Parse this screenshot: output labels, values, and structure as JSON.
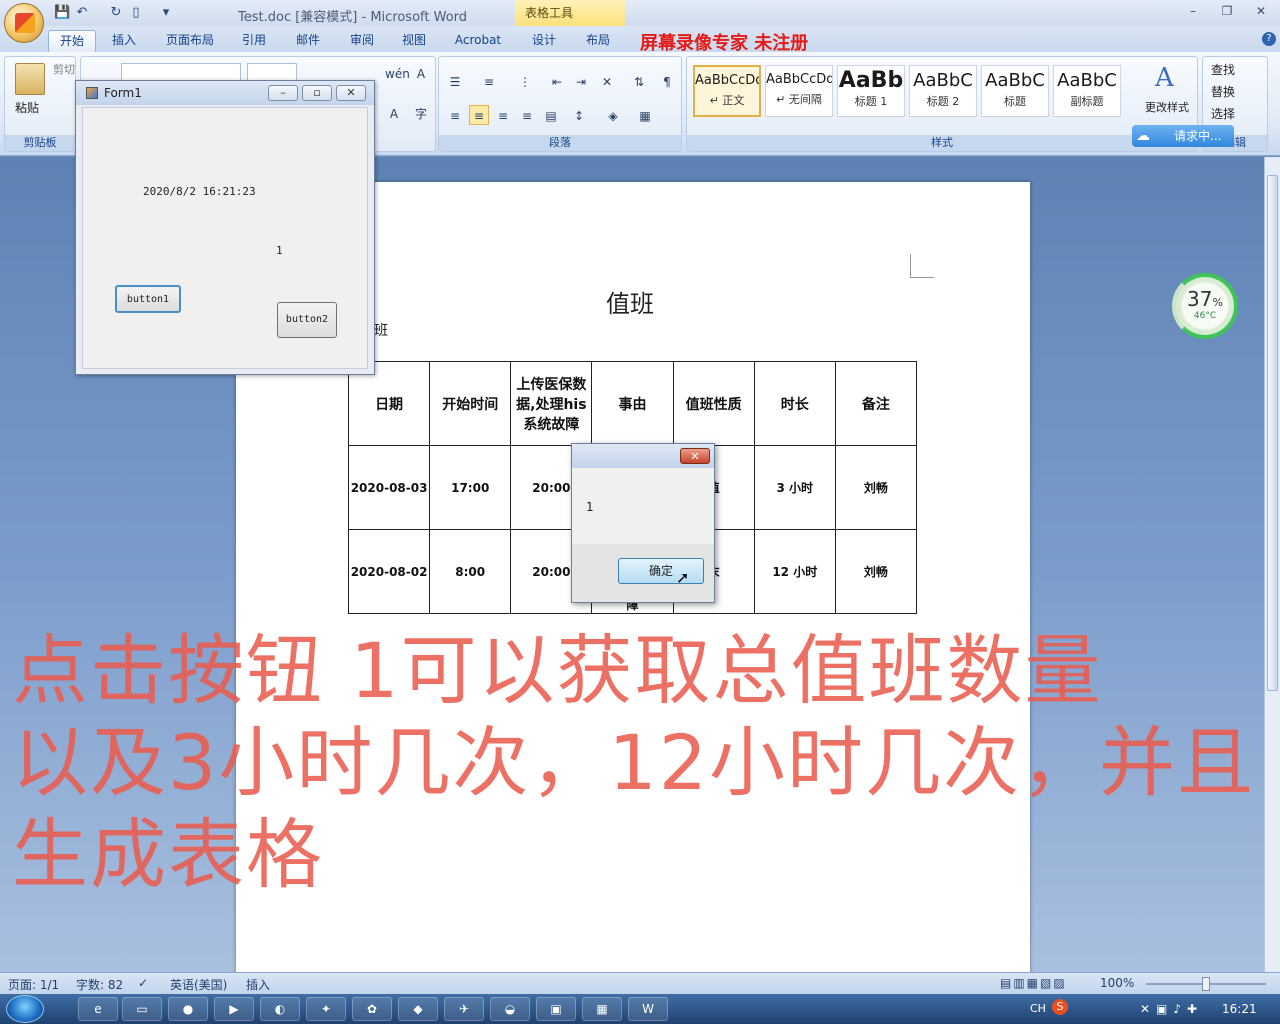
{
  "window": {
    "title": "Test.doc [兼容模式] - Microsoft Word",
    "context_tab": "表格工具",
    "controls": [
      "–",
      "❐",
      "✕"
    ]
  },
  "tabs": [
    {
      "label": "开始"
    },
    {
      "label": "插入"
    },
    {
      "label": "页面布局"
    },
    {
      "label": "引用"
    },
    {
      "label": "邮件"
    },
    {
      "label": "审阅"
    },
    {
      "label": "视图"
    },
    {
      "label": "Acrobat"
    },
    {
      "label": "设计"
    },
    {
      "label": "布局"
    }
  ],
  "recorder_watermark": "屏幕录像专家  未注册",
  "ribbon": {
    "clipboard": {
      "paste": "粘贴",
      "cut": "剪切",
      "label": "剪贴板"
    },
    "paragraph_label": "段落",
    "styles_label": "样式",
    "styles": [
      {
        "sample": "AaBbCcDd",
        "name": "↵ 正文"
      },
      {
        "sample": "AaBbCcDd",
        "name": "↵ 无间隔"
      },
      {
        "sample": "AaBb",
        "name": "标题 1"
      },
      {
        "sample": "AaBbC",
        "name": "标题 2"
      },
      {
        "sample": "AaBbC",
        "name": "标题"
      },
      {
        "sample": "AaBbC",
        "name": "副标题"
      }
    ],
    "change_styles": "更改样式",
    "editing": {
      "find": "查找",
      "replace": "替换",
      "select": "选择",
      "label": "编辑"
    },
    "request_badge": "请求中..."
  },
  "form1": {
    "title": "Form1",
    "datetime": "2020/8/2 16:21:23",
    "count": "1",
    "button1": "button1",
    "button2": "button2"
  },
  "document": {
    "title": "值班",
    "fragment": "班",
    "table": {
      "headers": [
        "日期",
        "开始时间",
        "上传医保数据,处理his 系统故障",
        "事由",
        "值班性质",
        "时长",
        "备注"
      ],
      "rows": [
        [
          "2020-08-03",
          "17:00",
          "20:00",
          "",
          "值",
          "3 小时",
          "刘畅"
        ],
        [
          "2020-08-02",
          "8:00",
          "20:00",
          "障",
          "末",
          "12 小时",
          "刘畅"
        ]
      ]
    }
  },
  "msgbox": {
    "message": "1",
    "ok": "确定",
    "close": "✕"
  },
  "caption": [
    "点击按钮 1可以获取总值班数量",
    "以及3小时几次，12小时几次，并且",
    "生成表格"
  ],
  "widget": {
    "percent": "37",
    "percent_sign": "%",
    "temp": "46°C"
  },
  "statusbar": {
    "page": "页面: 1/1",
    "words": "字数: 82",
    "language": "英语(美国)",
    "mode": "插入",
    "zoom": "100%"
  },
  "taskbar": {
    "clock": "16:21",
    "ime": "CH"
  }
}
